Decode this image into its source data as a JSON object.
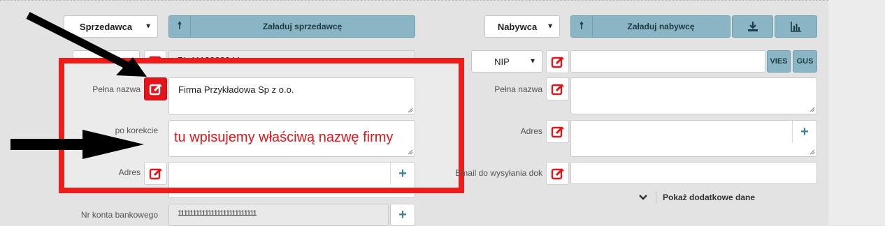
{
  "seller": {
    "select_value": "Sprzedawca",
    "load_button": "Załaduj sprzedawcę",
    "nip_select_value": "NIP",
    "nip_value": "PL 1112223344",
    "full_name_label": "Pełna nazwa",
    "full_name_value": "Firma Przykładowa Sp z o.o.",
    "correction_label": "po korekcie",
    "address_label": "Adres",
    "bank_label": "Nr konta bankowego",
    "bank_value": "11111111111111111111111111"
  },
  "annotation": {
    "text": "tu wpisujemy właściwą  nazwę firmy",
    "color": "#ef1c1c"
  },
  "buyer": {
    "select_value": "Nabywca",
    "load_button": "Załaduj nabywcę",
    "nip_select_value": "NIP",
    "vies_button": "VIES",
    "gus_button": "GUS",
    "full_name_label": "Pełna nazwa",
    "address_label": "Adres",
    "email_label": "Email do wysyłania dok",
    "more_label": "Pokaż dodatkowe dane"
  },
  "icons": {
    "up": "arrow-up-icon",
    "download": "download-icon",
    "chart": "bar-chart-icon",
    "edit": "edit-icon",
    "plus": "plus-icon",
    "chevron": "chevron-down-icon"
  },
  "colors": {
    "accent": "#8ab5c4",
    "edit_red": "#e2151a",
    "plus_blue": "#3e7f93"
  }
}
